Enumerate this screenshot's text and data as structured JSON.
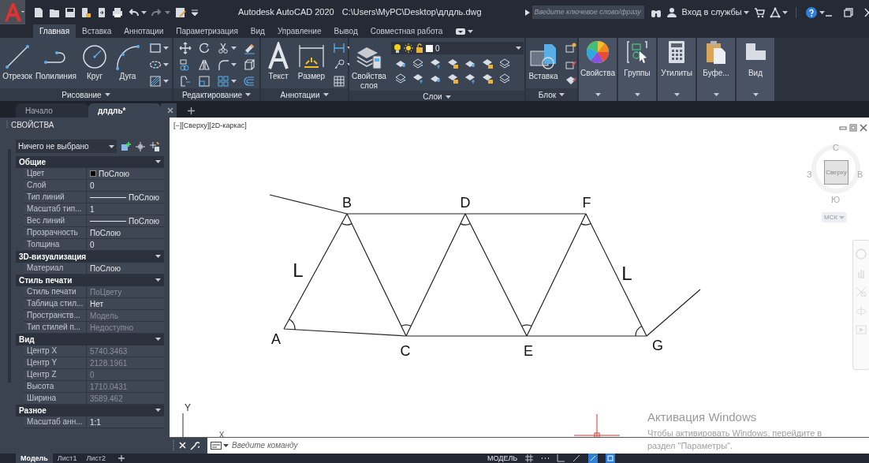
{
  "title_bar": {
    "app_title": "Autodesk AutoCAD 2020",
    "file_path": "C:\\Users\\MyPC\\Desktop\\длдль.dwg",
    "search_placeholder": "Введите ключевое слово/фразу",
    "sign_in": "Вход в службы"
  },
  "ribbon_tabs": [
    {
      "label": "Главная",
      "selected": true
    },
    {
      "label": "Вставка",
      "selected": false
    },
    {
      "label": "Аннотации",
      "selected": false
    },
    {
      "label": "Параметризация",
      "selected": false
    },
    {
      "label": "Вид",
      "selected": false
    },
    {
      "label": "Управление",
      "selected": false
    },
    {
      "label": "Вывод",
      "selected": false
    },
    {
      "label": "Совместная работа",
      "selected": false
    }
  ],
  "ribbon_panels": [
    {
      "kind": "tools",
      "title": "Рисование",
      "tools": [
        {
          "label": "Отрезок"
        },
        {
          "label": "Полилиния"
        },
        {
          "label": "Круг"
        },
        {
          "label": "Дуга"
        }
      ]
    },
    {
      "kind": "tools",
      "title": "Редактирование"
    },
    {
      "kind": "tools",
      "title": "Аннотации",
      "tools": [
        {
          "label": "Текст"
        },
        {
          "label": "Размер"
        }
      ]
    },
    {
      "kind": "layers",
      "title": "Слои",
      "tools": [
        {
          "label": "Свойства слоя"
        }
      ],
      "layer": "0"
    },
    {
      "kind": "tools",
      "title": "Блок",
      "tools": [
        {
          "label": "Вставка"
        }
      ]
    },
    {
      "kind": "collapsed",
      "label": "Свойства"
    },
    {
      "kind": "collapsed",
      "label": "Группы"
    },
    {
      "kind": "collapsed",
      "label": "Утилиты"
    },
    {
      "kind": "collapsed",
      "label": "Буфе..."
    },
    {
      "kind": "collapsed",
      "label": "Вид"
    }
  ],
  "doc_tabs": [
    {
      "label": "Начало",
      "selected": false
    },
    {
      "label": "длдль*",
      "selected": true
    }
  ],
  "properties": {
    "title": "СВОЙСТВА",
    "selection": "Ничего не выбрано",
    "sections": [
      {
        "title": "Общие",
        "rows": [
          {
            "name": "Цвет",
            "value": "ПоСлою",
            "kind": "color",
            "disabled": false
          },
          {
            "name": "Слой",
            "value": "0",
            "kind": "text",
            "disabled": false
          },
          {
            "name": "Тип линий",
            "value": "ПоСлою",
            "kind": "linetype",
            "disabled": false
          },
          {
            "name": "Масштаб тип...",
            "value": "1",
            "kind": "text",
            "disabled": false
          },
          {
            "name": "Вес линий",
            "value": "ПоСлою",
            "kind": "linetype",
            "disabled": false
          },
          {
            "name": "Прозрачность",
            "value": "ПоСлою",
            "kind": "text",
            "disabled": false
          },
          {
            "name": "Толщина",
            "value": "0",
            "kind": "text",
            "disabled": false
          }
        ]
      },
      {
        "title": "3D-визуализация",
        "rows": [
          {
            "name": "Материал",
            "value": "ПоСлою",
            "kind": "text",
            "disabled": false
          }
        ]
      },
      {
        "title": "Стиль печати",
        "rows": [
          {
            "name": "Стиль печати",
            "value": "ПоЦвету",
            "kind": "text",
            "disabled": true
          },
          {
            "name": "Таблица стил...",
            "value": "Нет",
            "kind": "text",
            "disabled": false
          },
          {
            "name": "Пространств...",
            "value": "Модель",
            "kind": "text",
            "disabled": true
          },
          {
            "name": "Тип стилей п...",
            "value": "Недоступно",
            "kind": "text",
            "disabled": true
          }
        ]
      },
      {
        "title": "Вид",
        "rows": [
          {
            "name": "Центр X",
            "value": "5740.3463",
            "kind": "text",
            "disabled": true
          },
          {
            "name": "Центр Y",
            "value": "2128.1961",
            "kind": "text",
            "disabled": true
          },
          {
            "name": "Центр Z",
            "value": "0",
            "kind": "text",
            "disabled": true
          },
          {
            "name": "Высота",
            "value": "1710.0431",
            "kind": "text",
            "disabled": true
          },
          {
            "name": "Ширина",
            "value": "3589.462",
            "kind": "text",
            "disabled": true
          }
        ]
      },
      {
        "title": "Разное",
        "rows": [
          {
            "name": "Масштаб анн...",
            "value": "1:1",
            "kind": "text",
            "disabled": false
          }
        ]
      }
    ]
  },
  "viewport": {
    "label": "[−][Сверху][2D-каркас]",
    "points": [
      {
        "label": "A"
      },
      {
        "label": "B"
      },
      {
        "label": "C"
      },
      {
        "label": "D"
      },
      {
        "label": "E"
      },
      {
        "label": "F"
      },
      {
        "label": "G"
      }
    ],
    "side_labels": [
      "L",
      "L"
    ],
    "viewcube": {
      "face": "Сверху",
      "north": "С",
      "south": "Ю",
      "east": "В",
      "west": "З",
      "ucs": "МСК"
    },
    "ucs_icon": {
      "y": "Y",
      "x": "X"
    }
  },
  "command_line": {
    "placeholder": "Введите команду"
  },
  "windows_notice": {
    "title": "Активация Windows",
    "text": "Чтобы активировать Windows, перейдите в раздел \"Параметры\"."
  },
  "layout_tabs": [
    {
      "label": "Модель",
      "selected": true
    },
    {
      "label": "Лист1",
      "selected": false
    },
    {
      "label": "Лист2",
      "selected": false
    }
  ],
  "status_bar": {
    "mode": "МОДЕЛЬ"
  }
}
